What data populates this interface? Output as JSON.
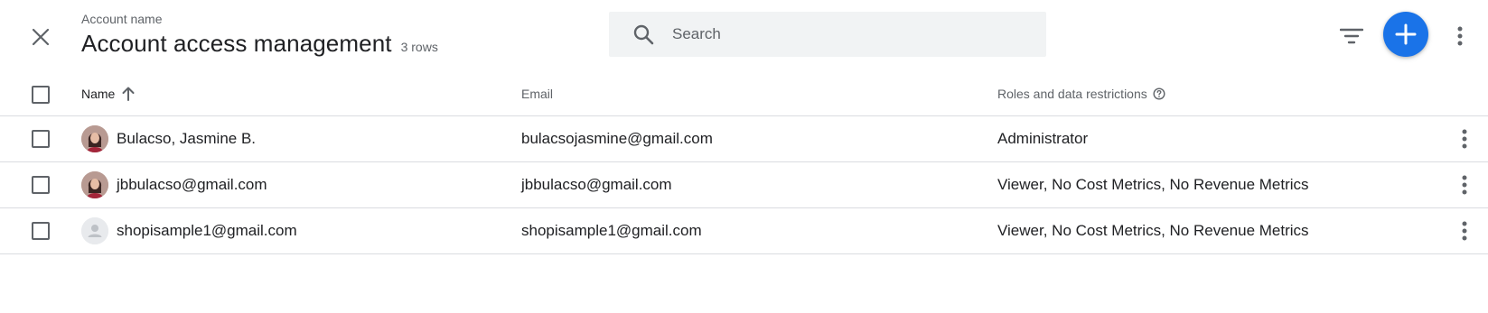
{
  "header": {
    "account_name": "Account name",
    "title": "Account access management",
    "row_count": "3 rows",
    "icons": {
      "close": "close-icon",
      "filter": "filter-icon",
      "add": "plus-icon",
      "more": "more-vert-icon"
    }
  },
  "search": {
    "placeholder": "Search",
    "value": "",
    "icon": "search-icon"
  },
  "colors": {
    "accent": "#1a73e8",
    "divider": "#dadce0",
    "search_bg": "#f1f3f4",
    "text": "#202124",
    "secondary_text": "#5f6368"
  },
  "table": {
    "columns": {
      "name": "Name",
      "email": "Email",
      "roles": "Roles and data restrictions"
    },
    "sort": {
      "column": "name",
      "direction": "ascending",
      "icon": "arrow-up-icon"
    },
    "roles_help_icon": "help-circle-icon",
    "rows": [
      {
        "name": "Bulacso, Jasmine B.",
        "email": "bulacsojasmine@gmail.com",
        "roles": "Administrator",
        "avatar": "user-photo"
      },
      {
        "name": "jbbulacso@gmail.com",
        "email": "jbbulacso@gmail.com",
        "roles": "Viewer, No Cost Metrics, No Revenue Metrics",
        "avatar": "user-photo"
      },
      {
        "name": "shopisample1@gmail.com",
        "email": "shopisample1@gmail.com",
        "roles": "Viewer, No Cost Metrics, No Revenue Metrics",
        "avatar": "default-person-icon"
      }
    ]
  }
}
